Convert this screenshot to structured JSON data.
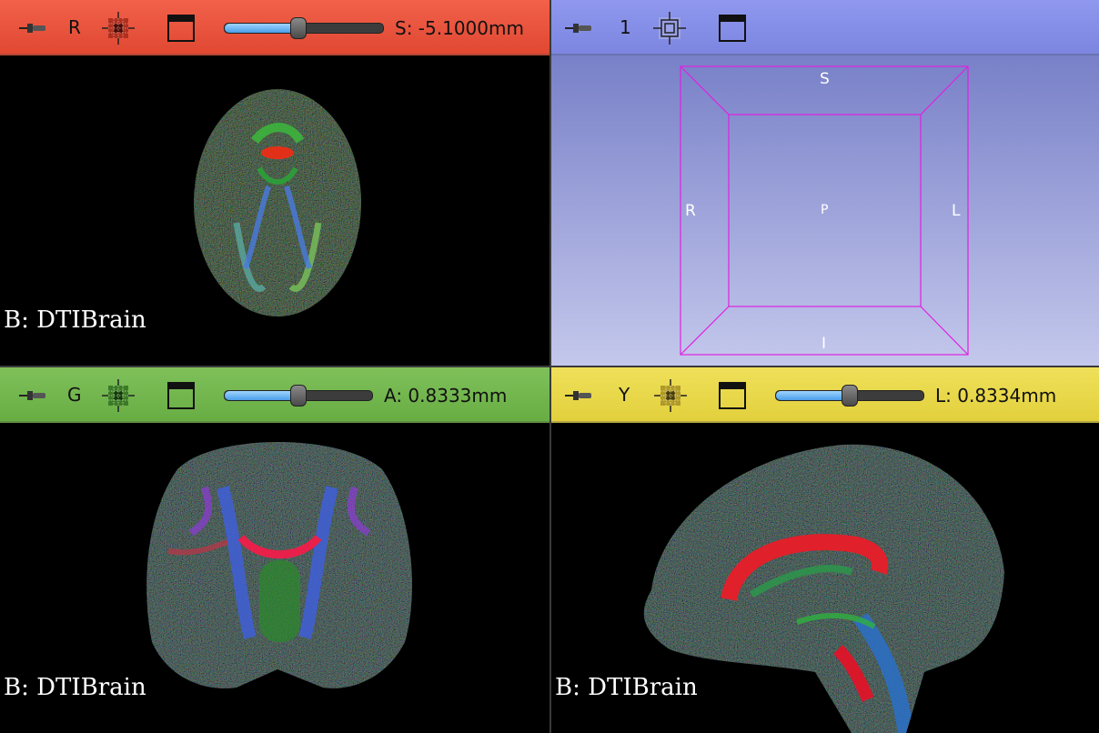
{
  "views": {
    "red": {
      "orientation_label": "R",
      "slice_readout": "S: -5.1000mm",
      "slider_fraction": 0.46,
      "background_label": "B: DTIBrain",
      "color": "#e9503a"
    },
    "threeD": {
      "view_label": "1",
      "axis": {
        "superior": "S",
        "inferior": "I",
        "right": "R",
        "left": "L",
        "posterior": "P"
      },
      "color": "#8890e8"
    },
    "green": {
      "orientation_label": "G",
      "slice_readout": "A: 0.8333mm",
      "slider_fraction": 0.5,
      "background_label": "B: DTIBrain",
      "color": "#72b64e"
    },
    "yellow": {
      "orientation_label": "Y",
      "slice_readout": "L: 0.8334mm",
      "slider_fraction": 0.5,
      "background_label": "B: DTIBrain",
      "color": "#e8d84a"
    }
  },
  "icons": {
    "pin": "pin-icon",
    "layer_grid": "slice-grid-icon",
    "view_window": "view-maximize-icon",
    "center_3d": "center-view-icon"
  }
}
